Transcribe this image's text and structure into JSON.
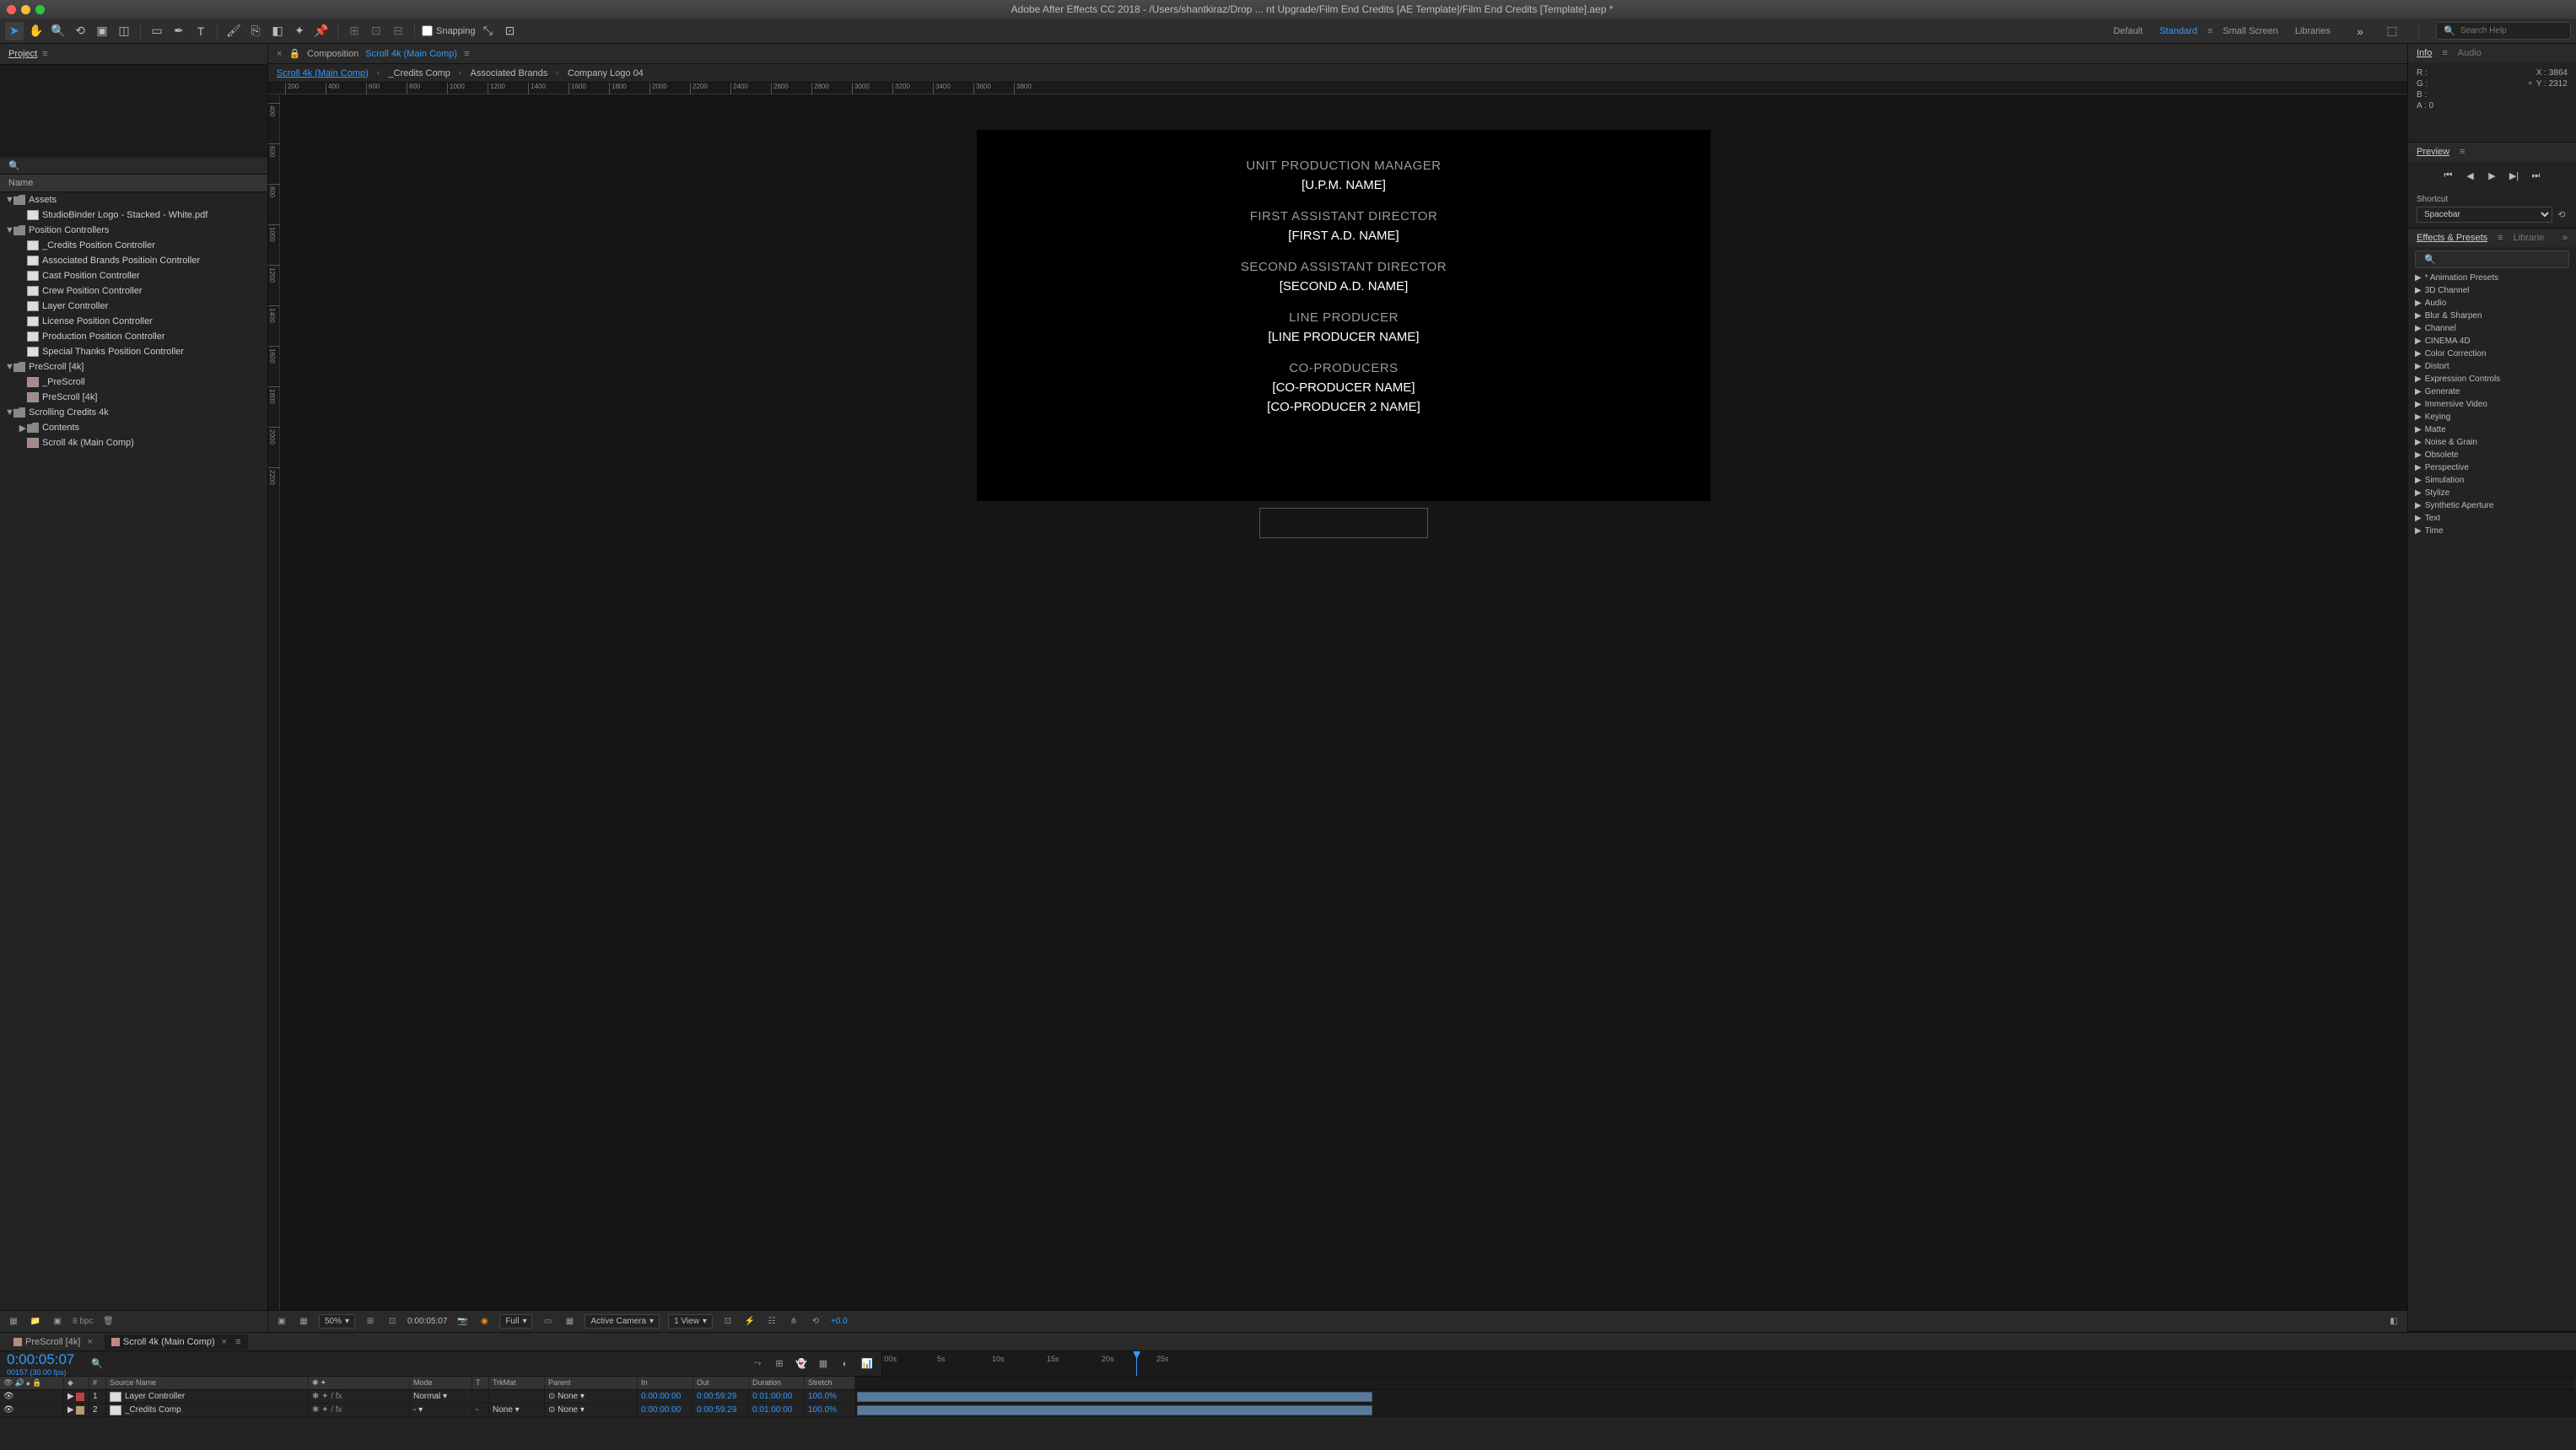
{
  "app": {
    "title": "Adobe After Effects CC 2018 - /Users/shantkiraz/Drop ... nt Upgrade/Film End Credits [AE Template]/Film End Credits [Template].aep *"
  },
  "toolbar": {
    "snapping": "Snapping",
    "workspaces": [
      "Default",
      "Standard",
      "Small Screen",
      "Libraries"
    ],
    "active_workspace": "Standard",
    "search_placeholder": "Search Help"
  },
  "project": {
    "tab": "Project",
    "name_header": "Name",
    "bpc": "8 bpc",
    "tree": [
      {
        "type": "folder",
        "label": "Assets",
        "expanded": true,
        "depth": 0
      },
      {
        "type": "file",
        "label": "StudioBinder Logo - Stacked - White.pdf",
        "depth": 1
      },
      {
        "type": "folder",
        "label": "Position Controllers",
        "expanded": true,
        "depth": 0
      },
      {
        "type": "item",
        "label": "_Credits Position Controller",
        "depth": 1
      },
      {
        "type": "item",
        "label": "Associated Brands Positioin Controller",
        "depth": 1
      },
      {
        "type": "item",
        "label": "Cast Position Controller",
        "depth": 1
      },
      {
        "type": "item",
        "label": "Crew Position Controller",
        "depth": 1
      },
      {
        "type": "item",
        "label": "Layer Controller",
        "depth": 1
      },
      {
        "type": "item",
        "label": "License Position Controller",
        "depth": 1
      },
      {
        "type": "item",
        "label": "Production Position Controller",
        "depth": 1
      },
      {
        "type": "item",
        "label": "Special Thanks Position Controller",
        "depth": 1
      },
      {
        "type": "folder",
        "label": "PreScroll [4k]",
        "expanded": true,
        "depth": 0
      },
      {
        "type": "comp",
        "label": "_PreScroll",
        "depth": 1
      },
      {
        "type": "comp",
        "label": "PreScroll [4k]",
        "depth": 1
      },
      {
        "type": "folder",
        "label": "Scrolling Credits 4k",
        "expanded": true,
        "depth": 0
      },
      {
        "type": "folder",
        "label": "Contents",
        "expanded": false,
        "depth": 1
      },
      {
        "type": "comp",
        "label": "Scroll 4k (Main Comp)",
        "depth": 1
      }
    ]
  },
  "composition": {
    "tab_label": "Composition",
    "active_comp": "Scroll 4k (Main Comp)",
    "flow": [
      "Scroll 4k (Main Comp)",
      "_Credits Comp",
      "Associated Brands",
      "Company Logo 04"
    ],
    "h_ticks": [
      "200",
      "400",
      "600",
      "800",
      "1000",
      "1200",
      "1400",
      "1600",
      "1800",
      "2000",
      "2200",
      "2400",
      "2600",
      "2800",
      "3000",
      "3200",
      "3400",
      "3600",
      "3800"
    ],
    "v_ticks": [
      "400",
      "600",
      "800",
      "1000",
      "1200",
      "1400",
      "1600",
      "1800",
      "2000",
      "2200"
    ],
    "credits": [
      {
        "role": "UNIT PRODUCTION MANAGER",
        "names": [
          "[U.P.M. NAME]"
        ]
      },
      {
        "role": "FIRST ASSISTANT DIRECTOR",
        "names": [
          "[FIRST A.D. NAME]"
        ]
      },
      {
        "role": "SECOND ASSISTANT DIRECTOR",
        "names": [
          "[SECOND A.D. NAME]"
        ]
      },
      {
        "role": "LINE PRODUCER",
        "names": [
          "[LINE PRODUCER NAME]"
        ]
      },
      {
        "role": "CO-PRODUCERS",
        "names": [
          "[CO-PRODUCER NAME]",
          "[CO-PRODUCER 2 NAME]"
        ]
      }
    ],
    "footer": {
      "zoom": "50%",
      "timecode": "0:00:05:07",
      "resolution": "Full",
      "camera": "Active Camera",
      "views": "1 View",
      "exposure": "+0.0"
    }
  },
  "info": {
    "tab": "Info",
    "audio_tab": "Audio",
    "r": "R :",
    "g": "G :",
    "b": "B :",
    "a_label": "A :",
    "a_val": "0",
    "x_label": "X :",
    "x_val": "3864",
    "y_label": "Y :",
    "y_val": "2312"
  },
  "preview": {
    "tab": "Preview",
    "shortcut_label": "Shortcut",
    "shortcut_value": "Spacebar"
  },
  "effects": {
    "tab": "Effects & Presets",
    "lib_tab": "Librarie",
    "categories": [
      "* Animation Presets",
      "3D Channel",
      "Audio",
      "Blur & Sharpen",
      "Channel",
      "CINEMA 4D",
      "Color Correction",
      "Distort",
      "Expression Controls",
      "Generate",
      "Immersive Video",
      "Keying",
      "Matte",
      "Noise & Grain",
      "Obsolete",
      "Perspective",
      "Simulation",
      "Stylize",
      "Synthetic Aperture",
      "Text",
      "Time"
    ]
  },
  "timeline": {
    "tabs": [
      {
        "label": "PreScroll [4k]",
        "active": false,
        "closable": true
      },
      {
        "label": "Scroll 4k (Main Comp)",
        "active": true,
        "closable": true
      }
    ],
    "timecode": "0:00:05:07",
    "framecount": "00157 (30.00 fps)",
    "ruler_labels": [
      ":00s",
      "5s",
      "10s",
      "15s",
      "20s",
      "25s"
    ],
    "cti_pct": 15,
    "columns": {
      "num": "#",
      "source": "Source Name",
      "mode": "Mode",
      "t": "T",
      "trkmat": "TrkMat",
      "parent": "Parent",
      "in": "In",
      "out": "Out",
      "duration": "Duration",
      "stretch": "Stretch"
    },
    "layers": [
      {
        "num": "1",
        "color": "#c04040",
        "name": "Layer Controller",
        "mode": "Normal",
        "trkmat": "",
        "parent": "None",
        "in": "0:00:00:00",
        "out": "0:00:59:29",
        "duration": "0:01:00:00",
        "stretch": "100.0%"
      },
      {
        "num": "2",
        "color": "#b0a070",
        "name": "_Credits Comp",
        "mode": "-",
        "trkmat": "None",
        "parent": "None",
        "in": "0:00:00:00",
        "out": "0:00:59:29",
        "duration": "0:01:00:00",
        "stretch": "100.0%"
      }
    ]
  }
}
